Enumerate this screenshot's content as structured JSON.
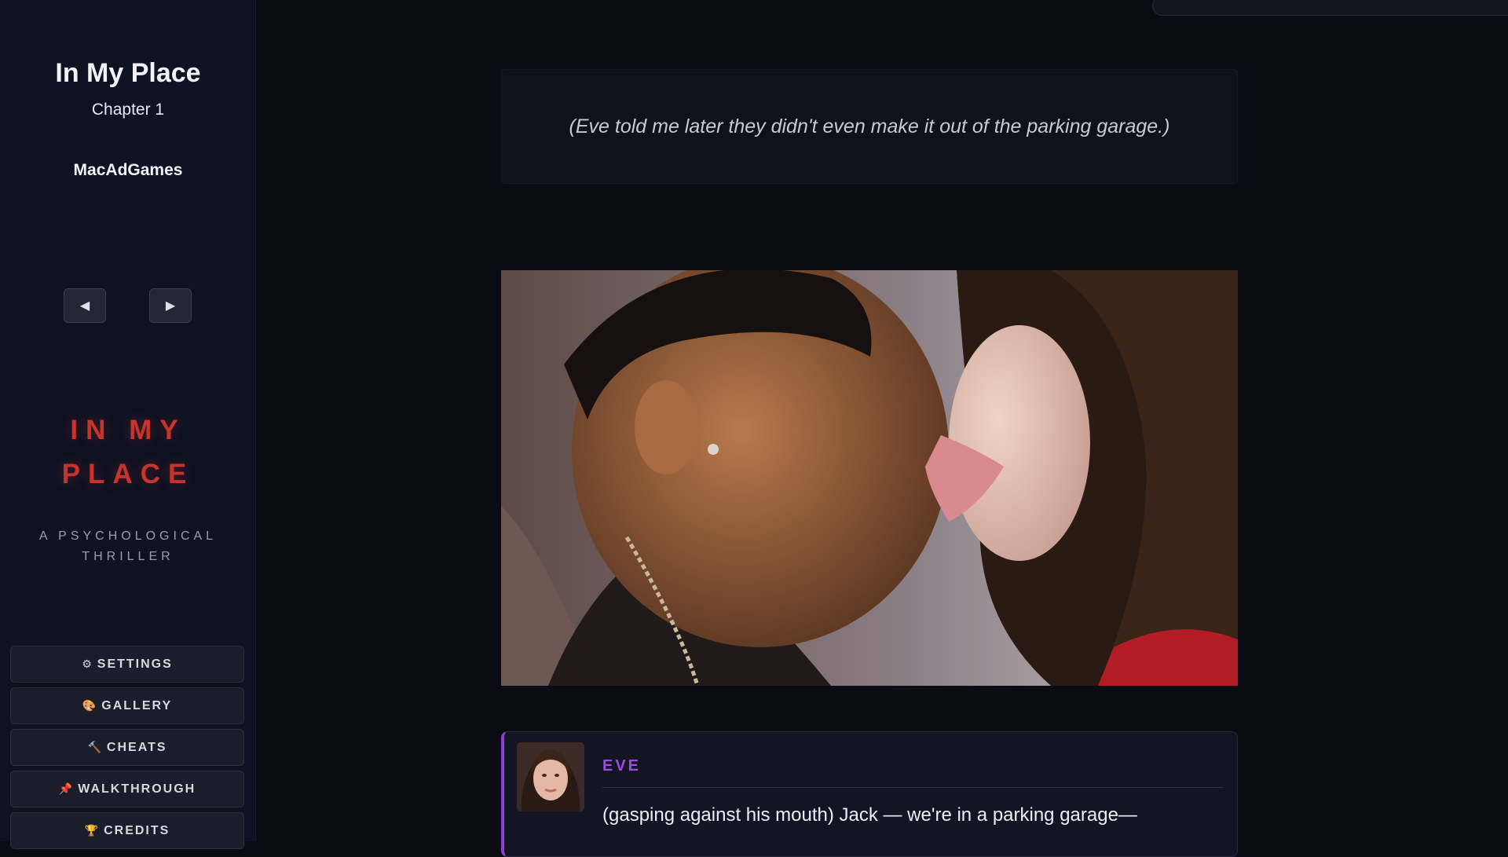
{
  "sidebar": {
    "title": "In My Place",
    "chapter": "Chapter 1",
    "author": "MacAdGames",
    "nav": {
      "prev": "◀",
      "next": "▶"
    },
    "logo": {
      "line1": "IN MY",
      "line2": "PLACE",
      "color": "#c8342c"
    },
    "tagline": "A PSYCHOLOGICAL THRILLER",
    "menu": [
      {
        "icon": "⚙",
        "icon_name": "gear-icon",
        "label": "SETTINGS"
      },
      {
        "icon": "🎨",
        "icon_name": "palette-icon",
        "label": "GALLERY"
      },
      {
        "icon": "🔨",
        "icon_name": "hammer-icon",
        "label": "CHEATS"
      },
      {
        "icon": "📌",
        "icon_name": "pin-icon",
        "label": "WALKTHROUGH"
      },
      {
        "icon": "🏆",
        "icon_name": "trophy-icon",
        "label": "CREDITS"
      }
    ]
  },
  "story": {
    "narration": "(Eve told me later they didn't even make it out of the parking garage.)",
    "dialog": {
      "speaker": "EVE",
      "speaker_color": "#9b4de0",
      "text": "(gasping against his mouth) Jack — we're in a parking garage—"
    }
  }
}
